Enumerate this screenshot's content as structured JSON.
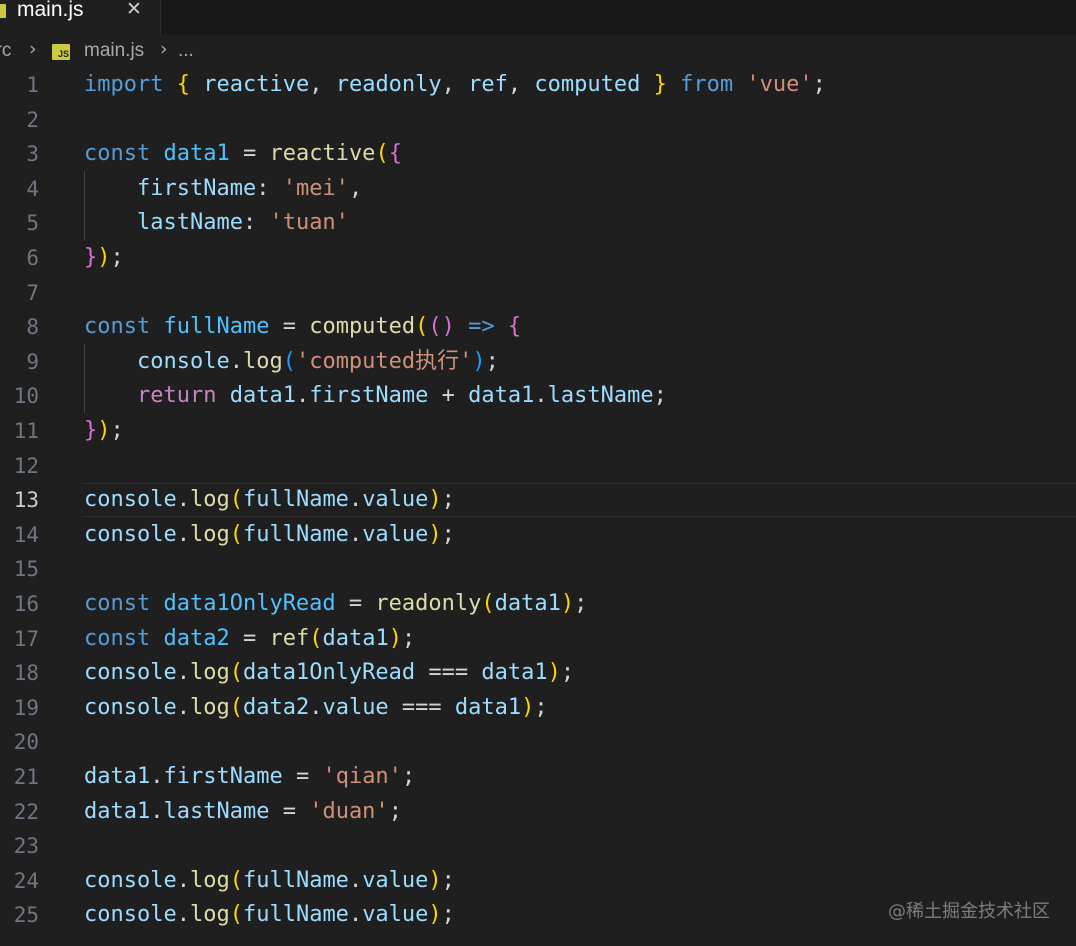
{
  "tab": {
    "label": "main.js",
    "close_glyph": "✕",
    "icon": "js-file-icon"
  },
  "breadcrumb": {
    "folder": "src",
    "separator": "›",
    "file_icon_text": "JS",
    "file": "main.js",
    "more": "..."
  },
  "colors": {
    "editor_bg": "#1f1f1f",
    "keyword": "#569cd6",
    "control": "#c586c0",
    "variable": "#9cdcfe",
    "constant": "#4fc1ff",
    "function": "#dcdcaa",
    "string": "#ce9178",
    "bracket_gold": "#ffd700",
    "bracket_orchid": "#da70d6",
    "bracket_blue": "#179fff"
  },
  "editor": {
    "current_line": 13,
    "lines": [
      {
        "n": "1",
        "tokens": [
          [
            "kw",
            "import"
          ],
          [
            "plain",
            " "
          ],
          [
            "b1",
            "{"
          ],
          [
            "plain",
            " "
          ],
          [
            "var",
            "reactive"
          ],
          [
            "plain",
            ", "
          ],
          [
            "var",
            "readonly"
          ],
          [
            "plain",
            ", "
          ],
          [
            "var",
            "ref"
          ],
          [
            "plain",
            ", "
          ],
          [
            "var",
            "computed"
          ],
          [
            "plain",
            " "
          ],
          [
            "b1",
            "}"
          ],
          [
            "plain",
            " "
          ],
          [
            "kw",
            "from"
          ],
          [
            "plain",
            " "
          ],
          [
            "str",
            "'vue'"
          ],
          [
            "plain",
            ";"
          ]
        ]
      },
      {
        "n": "2",
        "tokens": []
      },
      {
        "n": "3",
        "tokens": [
          [
            "kw",
            "const"
          ],
          [
            "plain",
            " "
          ],
          [
            "const",
            "data1"
          ],
          [
            "plain",
            " = "
          ],
          [
            "fn",
            "reactive"
          ],
          [
            "b1",
            "("
          ],
          [
            "b2",
            "{"
          ]
        ]
      },
      {
        "n": "4",
        "tokens": [
          [
            "plain",
            "    "
          ],
          [
            "var",
            "firstName"
          ],
          [
            "plain",
            ": "
          ],
          [
            "str",
            "'mei'"
          ],
          [
            "plain",
            ","
          ]
        ]
      },
      {
        "n": "5",
        "tokens": [
          [
            "plain",
            "    "
          ],
          [
            "var",
            "lastName"
          ],
          [
            "plain",
            ": "
          ],
          [
            "str",
            "'tuan'"
          ]
        ]
      },
      {
        "n": "6",
        "tokens": [
          [
            "b2",
            "}"
          ],
          [
            "b1",
            ")"
          ],
          [
            "plain",
            ";"
          ]
        ]
      },
      {
        "n": "7",
        "tokens": []
      },
      {
        "n": "8",
        "tokens": [
          [
            "kw",
            "const"
          ],
          [
            "plain",
            " "
          ],
          [
            "const",
            "fullName"
          ],
          [
            "plain",
            " = "
          ],
          [
            "fn",
            "computed"
          ],
          [
            "b1",
            "("
          ],
          [
            "b2",
            "()"
          ],
          [
            "plain",
            " "
          ],
          [
            "kw",
            "=>"
          ],
          [
            "plain",
            " "
          ],
          [
            "b2",
            "{"
          ]
        ]
      },
      {
        "n": "9",
        "tokens": [
          [
            "plain",
            "    "
          ],
          [
            "var",
            "console"
          ],
          [
            "plain",
            "."
          ],
          [
            "fn",
            "log"
          ],
          [
            "b3",
            "("
          ],
          [
            "str",
            "'computed执行'"
          ],
          [
            "b3",
            ")"
          ],
          [
            "plain",
            ";"
          ]
        ]
      },
      {
        "n": "10",
        "tokens": [
          [
            "plain",
            "    "
          ],
          [
            "ctl",
            "return"
          ],
          [
            "plain",
            " "
          ],
          [
            "var",
            "data1"
          ],
          [
            "plain",
            "."
          ],
          [
            "var",
            "firstName"
          ],
          [
            "plain",
            " + "
          ],
          [
            "var",
            "data1"
          ],
          [
            "plain",
            "."
          ],
          [
            "var",
            "lastName"
          ],
          [
            "plain",
            ";"
          ]
        ]
      },
      {
        "n": "11",
        "tokens": [
          [
            "b2",
            "}"
          ],
          [
            "b1",
            ")"
          ],
          [
            "plain",
            ";"
          ]
        ]
      },
      {
        "n": "12",
        "tokens": []
      },
      {
        "n": "13",
        "tokens": [
          [
            "var",
            "console"
          ],
          [
            "plain",
            "."
          ],
          [
            "fn",
            "log"
          ],
          [
            "b1",
            "("
          ],
          [
            "var",
            "fullName"
          ],
          [
            "plain",
            "."
          ],
          [
            "var",
            "value"
          ],
          [
            "b1",
            ")"
          ],
          [
            "plain",
            ";"
          ]
        ]
      },
      {
        "n": "14",
        "tokens": [
          [
            "var",
            "console"
          ],
          [
            "plain",
            "."
          ],
          [
            "fn",
            "log"
          ],
          [
            "b1",
            "("
          ],
          [
            "var",
            "fullName"
          ],
          [
            "plain",
            "."
          ],
          [
            "var",
            "value"
          ],
          [
            "b1",
            ")"
          ],
          [
            "plain",
            ";"
          ]
        ]
      },
      {
        "n": "15",
        "tokens": []
      },
      {
        "n": "16",
        "tokens": [
          [
            "kw",
            "const"
          ],
          [
            "plain",
            " "
          ],
          [
            "const",
            "data1OnlyRead"
          ],
          [
            "plain",
            " = "
          ],
          [
            "fn",
            "readonly"
          ],
          [
            "b1",
            "("
          ],
          [
            "var",
            "data1"
          ],
          [
            "b1",
            ")"
          ],
          [
            "plain",
            ";"
          ]
        ]
      },
      {
        "n": "17",
        "tokens": [
          [
            "kw",
            "const"
          ],
          [
            "plain",
            " "
          ],
          [
            "const",
            "data2"
          ],
          [
            "plain",
            " = "
          ],
          [
            "fn",
            "ref"
          ],
          [
            "b1",
            "("
          ],
          [
            "var",
            "data1"
          ],
          [
            "b1",
            ")"
          ],
          [
            "plain",
            ";"
          ]
        ]
      },
      {
        "n": "18",
        "tokens": [
          [
            "var",
            "console"
          ],
          [
            "plain",
            "."
          ],
          [
            "fn",
            "log"
          ],
          [
            "b1",
            "("
          ],
          [
            "var",
            "data1OnlyRead"
          ],
          [
            "plain",
            " === "
          ],
          [
            "var",
            "data1"
          ],
          [
            "b1",
            ")"
          ],
          [
            "plain",
            ";"
          ]
        ]
      },
      {
        "n": "19",
        "tokens": [
          [
            "var",
            "console"
          ],
          [
            "plain",
            "."
          ],
          [
            "fn",
            "log"
          ],
          [
            "b1",
            "("
          ],
          [
            "var",
            "data2"
          ],
          [
            "plain",
            "."
          ],
          [
            "var",
            "value"
          ],
          [
            "plain",
            " === "
          ],
          [
            "var",
            "data1"
          ],
          [
            "b1",
            ")"
          ],
          [
            "plain",
            ";"
          ]
        ]
      },
      {
        "n": "20",
        "tokens": []
      },
      {
        "n": "21",
        "tokens": [
          [
            "var",
            "data1"
          ],
          [
            "plain",
            "."
          ],
          [
            "var",
            "firstName"
          ],
          [
            "plain",
            " = "
          ],
          [
            "str",
            "'qian'"
          ],
          [
            "plain",
            ";"
          ]
        ]
      },
      {
        "n": "22",
        "tokens": [
          [
            "var",
            "data1"
          ],
          [
            "plain",
            "."
          ],
          [
            "var",
            "lastName"
          ],
          [
            "plain",
            " = "
          ],
          [
            "str",
            "'duan'"
          ],
          [
            "plain",
            ";"
          ]
        ]
      },
      {
        "n": "23",
        "tokens": []
      },
      {
        "n": "24",
        "tokens": [
          [
            "var",
            "console"
          ],
          [
            "plain",
            "."
          ],
          [
            "fn",
            "log"
          ],
          [
            "b1",
            "("
          ],
          [
            "var",
            "fullName"
          ],
          [
            "plain",
            "."
          ],
          [
            "var",
            "value"
          ],
          [
            "b1",
            ")"
          ],
          [
            "plain",
            ";"
          ]
        ]
      },
      {
        "n": "25",
        "tokens": [
          [
            "var",
            "console"
          ],
          [
            "plain",
            "."
          ],
          [
            "fn",
            "log"
          ],
          [
            "b1",
            "("
          ],
          [
            "var",
            "fullName"
          ],
          [
            "plain",
            "."
          ],
          [
            "var",
            "value"
          ],
          [
            "b1",
            ")"
          ],
          [
            "plain",
            ";"
          ]
        ]
      }
    ]
  },
  "watermark": "@稀土掘金技术社区"
}
